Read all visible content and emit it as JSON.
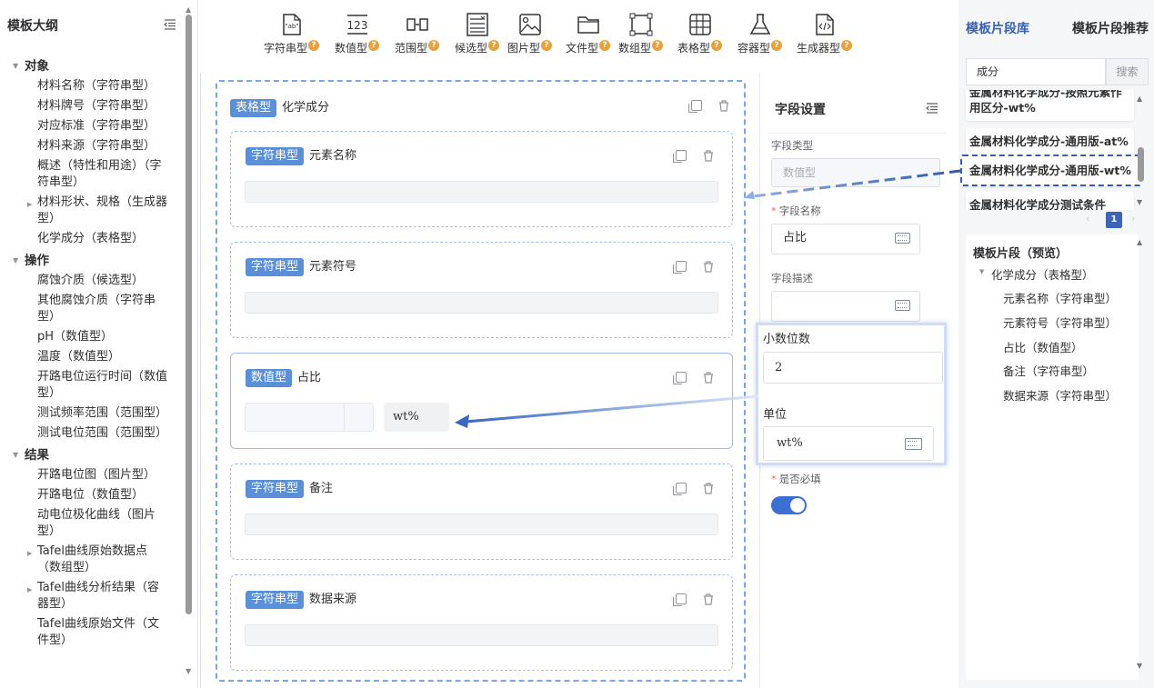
{
  "left": {
    "title": "模板大纲",
    "groups": [
      {
        "label": "对象",
        "items": [
          {
            "label": "材料名称（字符串型）"
          },
          {
            "label": "材料牌号（字符串型）"
          },
          {
            "label": "对应标准（字符串型）"
          },
          {
            "label": "材料来源（字符串型）"
          },
          {
            "label": "概述（特性和用途）（字符串型）"
          },
          {
            "label": "材料形状、规格（生成器型）"
          },
          {
            "label": "化学成分（表格型）"
          }
        ]
      },
      {
        "label": "操作",
        "items": [
          {
            "label": "腐蚀介质（候选型）"
          },
          {
            "label": "其他腐蚀介质（字符串型）"
          },
          {
            "label": "pH（数值型）"
          },
          {
            "label": "温度（数值型）"
          },
          {
            "label": "开路电位运行时间（数值型）"
          },
          {
            "label": "测试频率范围（范围型）"
          },
          {
            "label": "测试电位范围（范围型）"
          }
        ]
      },
      {
        "label": "结果",
        "items": [
          {
            "label": "开路电位图（图片型）"
          },
          {
            "label": "开路电位（数值型）"
          },
          {
            "label": "动电位极化曲线（图片型）"
          },
          {
            "label": "Tafel曲线原始数据点（数组型）"
          },
          {
            "label": "Tafel曲线分析结果（容器型）"
          },
          {
            "label": "Tafel曲线原始文件（文件型）"
          }
        ]
      }
    ]
  },
  "toolbar": {
    "tools": [
      {
        "label": "字符串型",
        "icon": "string-icon"
      },
      {
        "label": "数值型",
        "icon": "number-icon"
      },
      {
        "label": "范围型",
        "icon": "range-icon"
      },
      {
        "label": "候选型",
        "icon": "choice-icon"
      },
      {
        "label": "图片型",
        "icon": "image-icon"
      },
      {
        "label": "文件型",
        "icon": "folder-icon"
      },
      {
        "label": "数组型",
        "icon": "array-icon"
      },
      {
        "label": "表格型",
        "icon": "table-icon"
      },
      {
        "label": "容器型",
        "icon": "flask-icon"
      },
      {
        "label": "生成器型",
        "icon": "code-file-icon"
      }
    ],
    "help_mark": "?"
  },
  "canvas": {
    "table": {
      "tag": "表格型",
      "title": "化学成分"
    },
    "fields": [
      {
        "tag": "字符串型",
        "title": "元素名称"
      },
      {
        "tag": "字符串型",
        "title": "元素符号"
      },
      {
        "tag": "数值型",
        "title": "占比",
        "unit": "wt%"
      },
      {
        "tag": "字符串型",
        "title": "备注"
      },
      {
        "tag": "字符串型",
        "title": "数据来源"
      }
    ]
  },
  "settings": {
    "title": "字段设置",
    "type_label": "字段类型",
    "type_value": "数值型",
    "name_label": "字段名称",
    "name_value": "占比",
    "desc_label": "字段描述",
    "desc_value": "",
    "decimals_label": "小数位数",
    "decimals_value": "2",
    "unit_label": "单位",
    "unit_value": "wt%",
    "required_label": "是否必填",
    "required_on": true
  },
  "right": {
    "tab_library": "模板片段库",
    "tab_recommend": "模板片段推荐",
    "search_value": "成分",
    "search_button": "搜索",
    "results": [
      {
        "label": "金属材料化学成分-按照元素作用区分-wt%"
      },
      {
        "label": "金属材料化学成分-通用版-at%"
      },
      {
        "label": "金属材料化学成分-通用版-wt%"
      },
      {
        "label": "金属材料化学成分测试条件"
      }
    ],
    "page": "1",
    "preview_title": "模板片段（预览）",
    "preview_root": "化学成分（表格型）",
    "preview_children": [
      "元素名称（字符串型）",
      "元素符号（字符串型）",
      "占比（数值型）",
      "备注（字符串型）",
      "数据来源（字符串型）"
    ]
  },
  "colors": {
    "accent": "#3e64b8",
    "tag": "#5b8fd8",
    "help": "#e6a23c"
  }
}
